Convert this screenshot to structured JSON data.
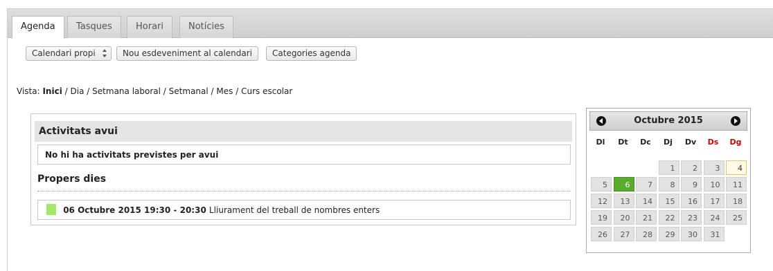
{
  "tabs": [
    {
      "label": "Agenda",
      "active": true
    },
    {
      "label": "Tasques",
      "active": false
    },
    {
      "label": "Horari",
      "active": false
    },
    {
      "label": "Notícies",
      "active": false
    }
  ],
  "toolbar": {
    "calendar_select": "Calendari propi",
    "new_event": "Nou esdeveniment al calendari",
    "categories": "Categories agenda"
  },
  "vista": {
    "prefix": "Vista:",
    "items": [
      "Inici",
      "Dia",
      "Setmana laboral",
      "Setmanal",
      "Mes",
      "Curs escolar"
    ],
    "separator": "/"
  },
  "today_panel": {
    "title": "Activitats avui",
    "empty_message": "No hi ha activitats previstes per avui",
    "upcoming_title": "Propers dies",
    "event": {
      "datetime": "06 Octubre 2015 19:30 - 20:30",
      "title": "Lliurament del treball de nombres enters",
      "color": "#a4e86a"
    }
  },
  "calendar": {
    "month_label": "Octubre 2015",
    "weekdays": [
      "Dl",
      "Dt",
      "Dc",
      "Dj",
      "Dv",
      "Ds",
      "Dg"
    ],
    "weeks": [
      [
        "",
        "",
        "",
        "1",
        "2",
        "3",
        "4"
      ],
      [
        "5",
        "6",
        "7",
        "8",
        "9",
        "10",
        "11"
      ],
      [
        "12",
        "13",
        "14",
        "15",
        "16",
        "17",
        "18"
      ],
      [
        "19",
        "20",
        "21",
        "22",
        "23",
        "24",
        "25"
      ],
      [
        "26",
        "27",
        "28",
        "29",
        "30",
        "31",
        ""
      ]
    ],
    "today": "6",
    "selected": "4",
    "colors": {
      "today": "#5bab2c",
      "weekend_label": "#cc0000"
    }
  }
}
